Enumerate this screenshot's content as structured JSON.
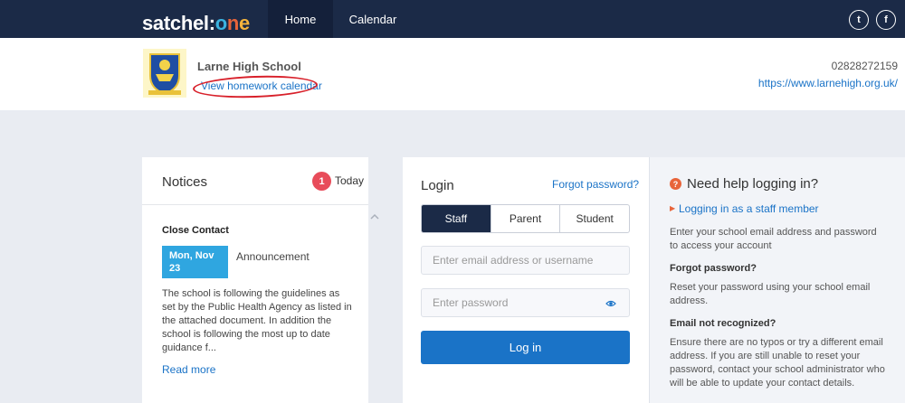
{
  "nav": {
    "logo_a": "satchel",
    "logo_colon": ":",
    "logo_o": "o",
    "logo_n": "n",
    "logo_e": "e",
    "items": [
      {
        "label": "Home"
      },
      {
        "label": "Calendar"
      }
    ],
    "social": [
      {
        "icon": "twitter-icon",
        "glyph": "t"
      },
      {
        "icon": "facebook-icon",
        "glyph": "f"
      }
    ]
  },
  "school": {
    "name": "Larne High School",
    "homework_link": "View homework calendar",
    "phone": "02828272159",
    "website": "https://www.larnehigh.org.uk/"
  },
  "notices": {
    "title": "Notices",
    "count": "1",
    "count_label": "Today",
    "item": {
      "title": "Close Contact",
      "date": "Mon, Nov 23",
      "type": "Announcement",
      "body": "The school is following the guidelines as set by the Public Health Agency as listed in the attached document.  In addition the school is following the most up to date guidance f...",
      "read_more": "Read more"
    }
  },
  "login": {
    "title": "Login",
    "forgot": "Forgot password?",
    "tabs": [
      {
        "label": "Staff",
        "active": true
      },
      {
        "label": "Parent",
        "active": false
      },
      {
        "label": "Student",
        "active": false
      }
    ],
    "email_placeholder": "Enter email address or username",
    "password_placeholder": "Enter password",
    "button": "Log in"
  },
  "help": {
    "icon": "question-icon",
    "title": "Need help logging in?",
    "link": "Logging in as a staff member",
    "intro": "Enter your school email address and password to access your account",
    "forgot_heading": "Forgot password?",
    "forgot_text": "Reset your password using your school email address.",
    "not_recognized_heading": "Email not recognized?",
    "not_recognized_text": "Ensure there are no typos or try a different email address. If you are still unable to reset your password, contact your school administrator who will be able to update your contact details."
  },
  "colors": {
    "nav_bg": "#1b2a47",
    "link": "#1a73c7",
    "badge": "#e84c5a",
    "date_box": "#2fa6e0",
    "accent_orange": "#e8643a"
  }
}
